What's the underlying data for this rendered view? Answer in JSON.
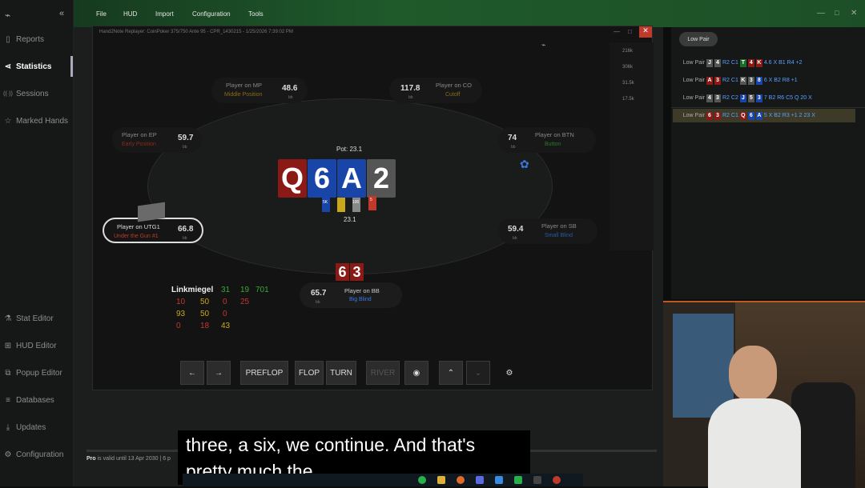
{
  "app": {
    "logo": "⌁",
    "collapse": "«"
  },
  "sidebar": {
    "top": [
      {
        "icon": "▯",
        "label": "Reports"
      },
      {
        "icon": "⋖",
        "label": "Statistics"
      },
      {
        "icon": "((·))",
        "label": "Sessions"
      },
      {
        "icon": "☆",
        "label": "Marked Hands"
      }
    ],
    "bottom": [
      {
        "icon": "⚗",
        "label": "Stat Editor"
      },
      {
        "icon": "⊞",
        "label": "HUD Editor"
      },
      {
        "icon": "⧉",
        "label": "Popup Editor"
      },
      {
        "icon": "≡",
        "label": "Databases"
      },
      {
        "icon": "⤓",
        "label": "Updates"
      },
      {
        "icon": "⚙",
        "label": "Configuration"
      }
    ]
  },
  "menu": [
    "File",
    "HUD",
    "Import",
    "Configuration",
    "Tools"
  ],
  "window_controls": [
    "—",
    "□",
    "✕"
  ],
  "replayer": {
    "title": "Hand2Note Replayer: CoinPoker 375/750 Ante 95 - CPR_1430215 - 1/25/2026 7:39:02 PM",
    "pot": "Pot: 23.1",
    "pot_total": "23.1",
    "board": [
      {
        "rank": "Q",
        "color": "#8b1a16"
      },
      {
        "rank": "6",
        "color": "#1a45a8"
      },
      {
        "rank": "A",
        "color": "#1a45a8"
      },
      {
        "rank": "2",
        "color": "#555555"
      }
    ],
    "hero_cards": [
      "6",
      "3"
    ],
    "chip_labels": [
      "5K",
      "100",
      "5"
    ],
    "seats": [
      {
        "name": "Player on MP",
        "pos": "Middle Position",
        "stack": "48.6",
        "bb": "bb",
        "pos_color": "#8a6a1a"
      },
      {
        "name": "Player on CO",
        "pos": "Cutoff",
        "stack": "117.8",
        "bb": "bb",
        "pos_color": "#8a6a1a"
      },
      {
        "name": "Player on EP",
        "pos": "Early Position",
        "stack": "59.7",
        "bb": "bb",
        "pos_color": "#8b2a1a"
      },
      {
        "name": "Player on BTN",
        "pos": "Button",
        "stack": "74",
        "bb": "bb",
        "pos_color": "#2a7a2a"
      },
      {
        "name": "Player on UTG1",
        "pos": "Under the Gun #1",
        "stack": "66.8",
        "bb": "bb",
        "pos_color": "#c0392b"
      },
      {
        "name": "Player on SB",
        "pos": "Small Blind",
        "stack": "59.4",
        "bb": "bb",
        "pos_color": "#2a5aa0"
      },
      {
        "name": "Player on BB",
        "pos": "Big Blind",
        "stack": "65.7",
        "bb": "bb",
        "pos_color": "#3a7ae0"
      }
    ],
    "side_values": [
      "216k",
      "306k",
      "31.5k",
      "17.5k"
    ],
    "stats": {
      "player": "Linkmiegel",
      "r1": [
        "31",
        "19",
        "701"
      ],
      "r2": [
        "10",
        "50",
        "0",
        "25"
      ],
      "r3": [
        "93",
        "50",
        "0"
      ],
      "r4": [
        "0",
        "18",
        "43"
      ]
    },
    "controls": {
      "prev": "←",
      "next": "→",
      "preflop": "PREFLOP",
      "flop": "FLOP",
      "turn": "TURN",
      "river": "RIVER",
      "eye": "◉",
      "up": "⌃",
      "down": "⌄",
      "gear": "⚙"
    }
  },
  "status": {
    "pro": "Pro",
    "valid": "is valid until 13 Apr 2030 | 6 p"
  },
  "right_panel": {
    "chip": "Low Pair",
    "rows": [
      {
        "label": "Low Pair",
        "cards": [
          [
            "J",
            "k"
          ],
          [
            "4",
            "k"
          ]
        ],
        "tail": "R2 C1",
        "board": [
          [
            "T",
            "g"
          ],
          [
            "4",
            "r"
          ],
          [
            "K",
            "r"
          ]
        ],
        "end": "4.6 X B1 R4 +2"
      },
      {
        "label": "Low Pair",
        "cards": [
          [
            "A",
            "r"
          ],
          [
            "3",
            "r"
          ]
        ],
        "tail": "R2 C1",
        "board": [
          [
            "K",
            "k"
          ],
          [
            "3",
            "k"
          ],
          [
            "8",
            "b"
          ]
        ],
        "end": "6 X B2 R8 +1"
      },
      {
        "label": "Low Pair",
        "cards": [
          [
            "4",
            "k"
          ],
          [
            "3",
            "k"
          ]
        ],
        "tail": "R2 C2",
        "board": [
          [
            "J",
            "b"
          ],
          [
            "5",
            "k"
          ],
          [
            "3",
            "b"
          ]
        ],
        "end": "7 B2 R6 C5 Q 20 X"
      },
      {
        "label": "Low Pair",
        "cards": [
          [
            "6",
            "r"
          ],
          [
            "3",
            "r"
          ]
        ],
        "tail": "R2 C1",
        "board": [
          [
            "Q",
            "r"
          ],
          [
            "6",
            "b"
          ],
          [
            "A",
            "b"
          ]
        ],
        "end": "5 X B2 R3 +1 2 23 X"
      }
    ]
  },
  "subtitles": {
    "line1": "three, a six, we continue. And that's",
    "line2": "pretty much the"
  }
}
